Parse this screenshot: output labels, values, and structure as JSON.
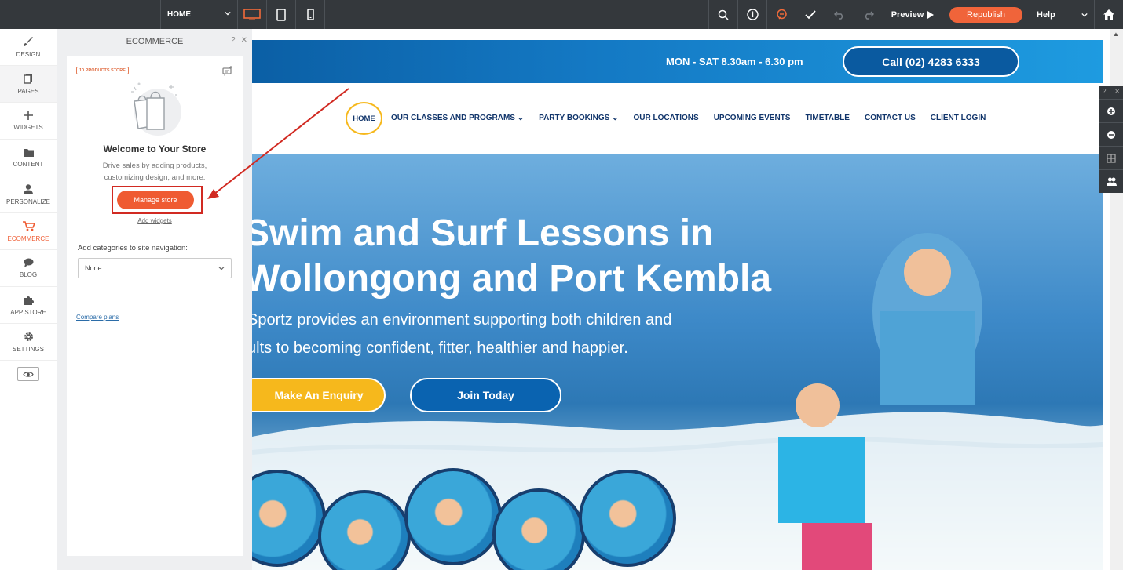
{
  "toolbar": {
    "page_select": "HOME",
    "preview": "Preview",
    "republish": "Republish",
    "help": "Help"
  },
  "leftnav": {
    "items": [
      {
        "label": "DESIGN",
        "icon": "brush-icon"
      },
      {
        "label": "PAGES",
        "icon": "pages-icon"
      },
      {
        "label": "WIDGETS",
        "icon": "plus-icon"
      },
      {
        "label": "CONTENT",
        "icon": "folder-icon"
      },
      {
        "label": "PERSONALIZE",
        "icon": "person-icon"
      },
      {
        "label": "ECOMMERCE",
        "icon": "cart-icon"
      },
      {
        "label": "BLOG",
        "icon": "chat-bubble-icon"
      },
      {
        "label": "APP STORE",
        "icon": "puzzle-icon"
      },
      {
        "label": "SETTINGS",
        "icon": "gear-icon"
      }
    ],
    "accent": "#ef5b32"
  },
  "panel": {
    "title": "ECOMMERCE",
    "help": "?",
    "close": "✕",
    "badge": "10 PRODUCTS STORE",
    "heading": "Welcome to Your Store",
    "description": "Drive sales by adding products, customizing design, and more.",
    "manage_button": "Manage store",
    "add_widgets": "Add widgets",
    "categories_label": "Add categories to site navigation:",
    "categories_value": "None",
    "compare_plans": "Compare plans"
  },
  "site": {
    "hours": "MON - SAT  8.30am - 6.30 pm",
    "call": "Call (02) 4283 6333",
    "nav": {
      "home": "HOME",
      "links": [
        "OUR CLASSES AND PROGRAMS",
        "PARTY BOOKINGS",
        "OUR LOCATIONS",
        "UPCOMING EVENTS",
        "TIMETABLE",
        "CONTACT US",
        "CLIENT LOGIN"
      ]
    },
    "hero": {
      "title_line1": "Swim and Surf Lessons in",
      "title_line2": "Wollongong and Port Kembla",
      "sub_line1": "Sportz provides an environment supporting both children and",
      "sub_line2": "ults to becoming confident, fitter, healthier and happier.",
      "enquiry": "Make An Enquiry",
      "join": "Join Today"
    }
  },
  "colors": {
    "brand_orange": "#f0643a",
    "site_blue": "#0a5aa0",
    "site_yellow": "#f6b81c",
    "annotation_red": "#d12a22"
  }
}
